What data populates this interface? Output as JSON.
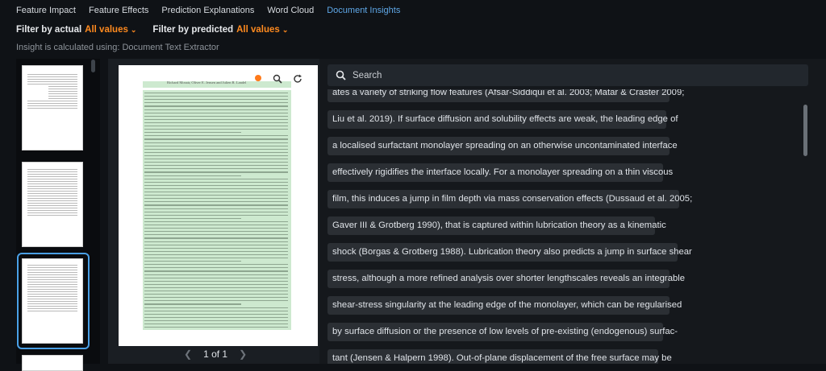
{
  "tabs": [
    {
      "label": "Feature Impact"
    },
    {
      "label": "Feature Effects"
    },
    {
      "label": "Prediction Explanations"
    },
    {
      "label": "Word Cloud"
    },
    {
      "label": "Document Insights"
    }
  ],
  "filters": {
    "actual_label": "Filter by actual",
    "actual_value": "All values",
    "predicted_label": "Filter by predicted",
    "predicted_value": "All values"
  },
  "insight_text": "Insight is calculated using: Document Text Extractor",
  "document": {
    "author_line": "Richard Mcnair, Oliver E. Jensen and Julien R. Landel",
    "pager": "1 of 1"
  },
  "search": {
    "placeholder": "Search"
  },
  "text_lines": [
    "ates a variety of striking flow features (Afsar-Siddiqui et al. 2003; Matar & Craster 2009;",
    "Liu et al. 2019). If surface diffusion and solubility effects are weak, the leading edge of",
    "a localised surfactant monolayer spreading on an otherwise uncontaminated interface",
    "effectively rigidifies the interface locally. For a monolayer spreading on a thin viscous",
    "film, this induces a jump in film depth via mass conservation effects (Dussaud et al. 2005;",
    "Gaver III & Grotberg 1990), that is captured within lubrication theory as a kinematic",
    "shock (Borgas & Grotberg 1988). Lubrication theory also predicts a jump in surface shear",
    "stress, although a more refined analysis over shorter lengthscales reveals an integrable",
    "shear-stress singularity at the leading edge of the monolayer, which can be regularised",
    "by surface diffusion or the presence of low levels of pre-existing (endogenous) surfac-",
    "tant (Jensen & Halpern 1998). Out-of-plane displacement of the free surface may be"
  ],
  "colors": {
    "accent": "#ff8a1f",
    "active_tab": "#5fa8e8",
    "selection": "#4aa0e6",
    "highlight": "#cde9cf"
  }
}
